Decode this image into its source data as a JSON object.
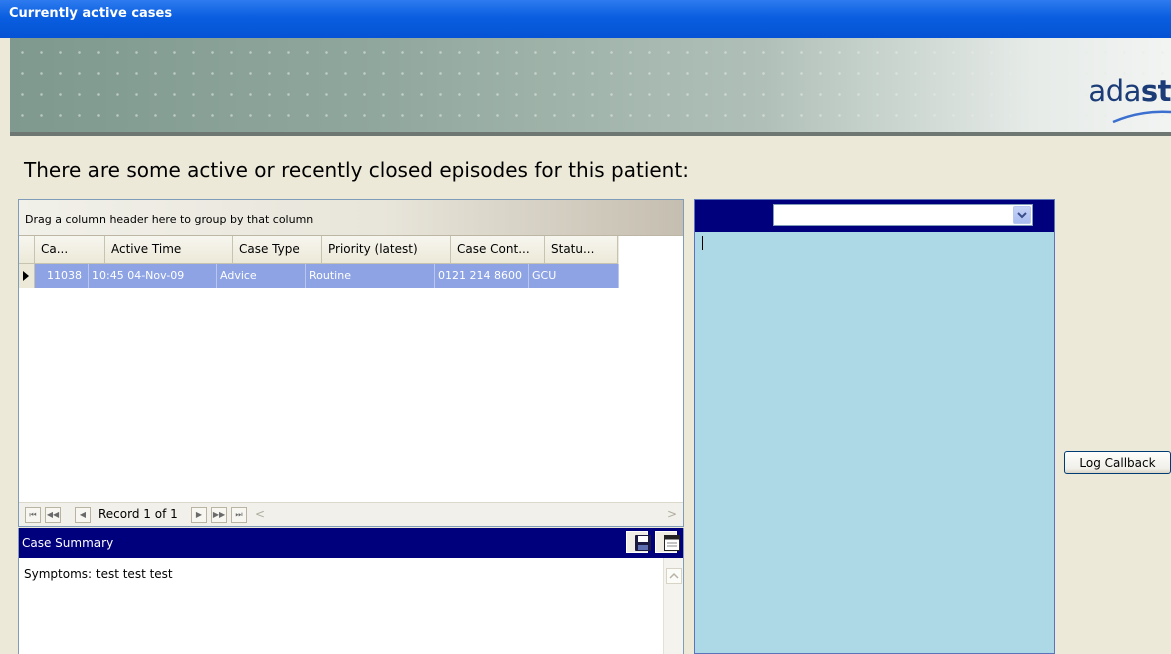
{
  "window": {
    "title": "Currently active cases"
  },
  "banner": {
    "logo_regular": "ada",
    "logo_bold": "st"
  },
  "heading": "There are some active or recently closed episodes for this patient:",
  "grid": {
    "group_hint": "Drag a column header here to group by that column",
    "columns": [
      "Ca...",
      "Active Time",
      "Case Type",
      "Priority (latest)",
      "Case Cont...",
      "Statu..."
    ],
    "rows": [
      {
        "case_no": "11038",
        "active_time": "10:45  04-Nov-09",
        "case_type": "Advice",
        "priority": "Routine",
        "contact": "0121 214 8600",
        "status": "GCU"
      }
    ],
    "navigator": {
      "record_text": "Record 1 of 1"
    }
  },
  "case_summary": {
    "title": "Case Summary",
    "text": "Symptoms: test test test"
  },
  "right_panel": {
    "dropdown_value": ""
  },
  "actions": {
    "log_callback": "Log Callback"
  },
  "colors": {
    "title_bar": "#0553d4",
    "header_navy": "#00007d",
    "selected_row": "#8da3e3",
    "notes_panel": "#add8e6"
  }
}
